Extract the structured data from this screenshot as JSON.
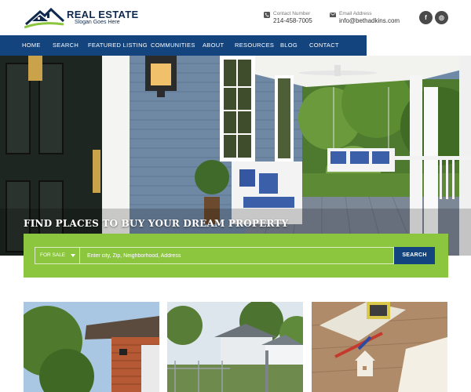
{
  "header": {
    "logo": {
      "title": "REAL ESTATE",
      "slogan": "Slogan Goes Here"
    },
    "contact_phone": {
      "label": "Contact Number",
      "value": "214-458-7005",
      "icon": "phone-icon"
    },
    "contact_email": {
      "label": "Email Address",
      "value": "info@bethadkins.com",
      "icon": "envelope-icon"
    },
    "social": [
      {
        "name": "facebook-icon",
        "glyph": "f"
      },
      {
        "name": "instagram-icon",
        "glyph": "◎"
      }
    ]
  },
  "nav": {
    "items": [
      "HOME",
      "SEARCH",
      "FEATURED LISTING",
      "COMMUNITIES",
      "ABOUT",
      "RESOURCES",
      "BLOG",
      "CONTACT"
    ]
  },
  "hero": {
    "title": "FIND PLACES TO BUY YOUR DREAM PROPERTY"
  },
  "search": {
    "type_selected": "FOR SALE",
    "placeholder": "Enter city, Zip, Neighborhood, Address",
    "button_label": "SEARCH"
  },
  "colors": {
    "nav_bg": "#13447e",
    "accent_green": "#8cc63f",
    "brand_navy": "#0f2a4e"
  }
}
